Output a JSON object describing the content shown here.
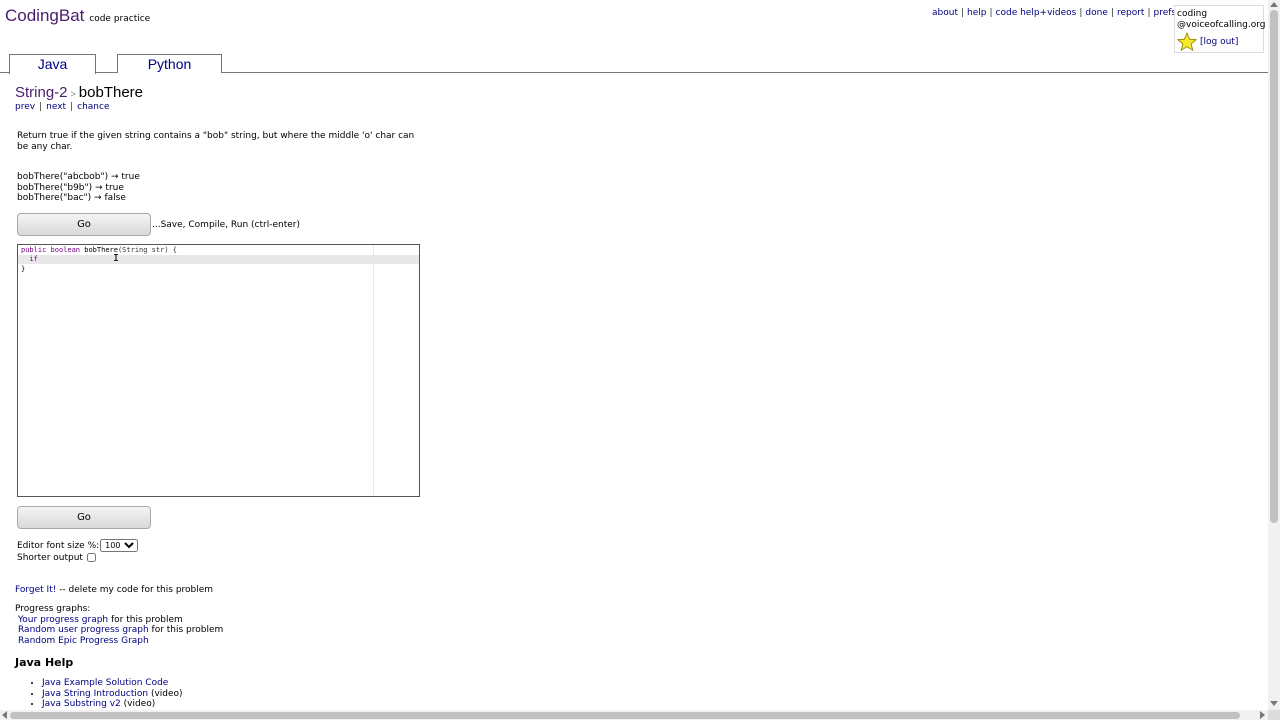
{
  "header": {
    "brand": "CodingBat",
    "tagline": "code practice",
    "links": [
      "about",
      "help",
      "code help+videos",
      "done",
      "report",
      "prefs"
    ]
  },
  "user": {
    "name": "coding",
    "domain": "@voiceofcalling.org",
    "logout": "[log out]",
    "star_icon": "star-icon"
  },
  "tabs": [
    {
      "label": "Java",
      "active": true
    },
    {
      "label": "Python",
      "active": false
    }
  ],
  "problem": {
    "category": "String-2",
    "separator": ">",
    "name": "bobThere",
    "nav": {
      "prev": "prev",
      "next": "next",
      "chance": "chance"
    },
    "description": "Return true if the given string contains a \"bob\" string, but where the middle 'o' char can be any char.",
    "examples": [
      "bobThere(\"abcbob\") → true",
      "bobThere(\"b9b\") → true",
      "bobThere(\"bac\") → false"
    ]
  },
  "go": {
    "label": "Go",
    "hint": "...Save, Compile, Run (ctrl-enter)"
  },
  "editor": {
    "line1": {
      "kw1": "public",
      "kw2": "boolean",
      "fn": "bobThere",
      "rest": "(String str) {"
    },
    "line2": "  if",
    "line3": "}"
  },
  "options": {
    "font_size_label": "Editor font size %:",
    "font_size_value": "100",
    "shorter_label": "Shorter output",
    "shorter_checked": false
  },
  "forget": {
    "link": "Forget It!",
    "rest": " -- delete my code for this problem"
  },
  "progress": {
    "title": "Progress graphs:",
    "items": [
      {
        "link": "Your progress graph",
        "rest": " for this problem"
      },
      {
        "link": "Random user progress graph",
        "rest": " for this problem"
      },
      {
        "link": "Random Epic Progress Graph",
        "rest": ""
      }
    ]
  },
  "java_help": {
    "title": "Java Help",
    "items": [
      {
        "link": "Java Example Solution Code",
        "rest": ""
      },
      {
        "link": "Java String Introduction",
        "rest": " (video)"
      },
      {
        "link": "Java Substring v2",
        "rest": " (video)"
      }
    ]
  },
  "colors": {
    "brand": "#4b1c6e",
    "link": "#000080",
    "keyword": "#770088"
  }
}
